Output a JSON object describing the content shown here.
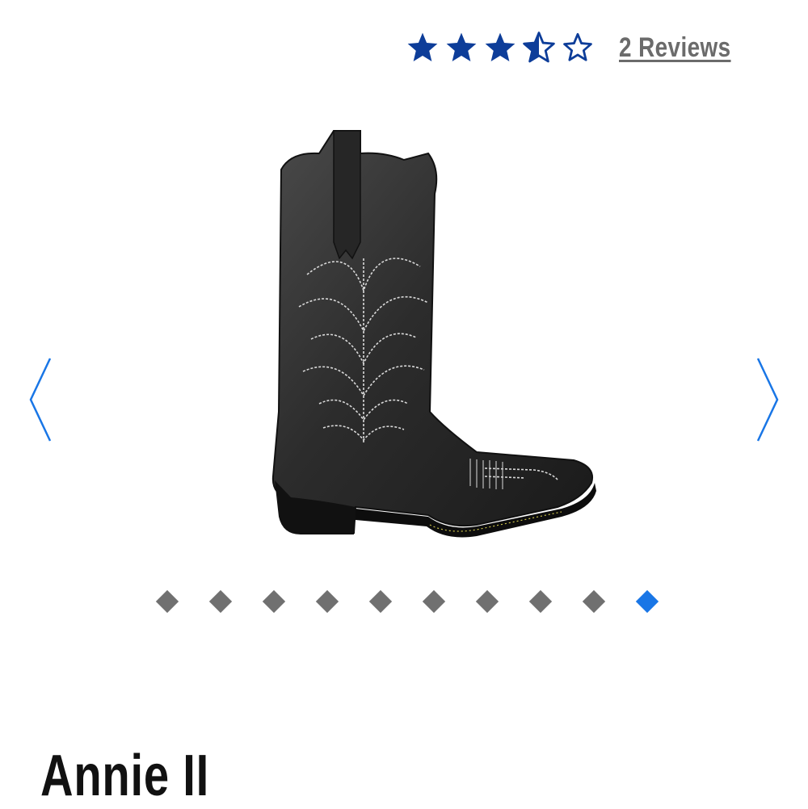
{
  "rating": {
    "value": 3.5,
    "max": 5,
    "stars": [
      "full",
      "full",
      "full",
      "half",
      "empty"
    ],
    "reviews_label": "2 Reviews",
    "star_color": "#0d3d99"
  },
  "carousel": {
    "image_subject": "black leather western cowboy boot with white stitching",
    "prev_icon": "chevron-left-icon",
    "next_icon": "chevron-right-icon",
    "arrow_color": "#1976e6",
    "slide_count": 10,
    "active_index": 9,
    "dot_color": "#707070",
    "active_dot_color": "#1976e6"
  },
  "product": {
    "name": "Annie II"
  }
}
